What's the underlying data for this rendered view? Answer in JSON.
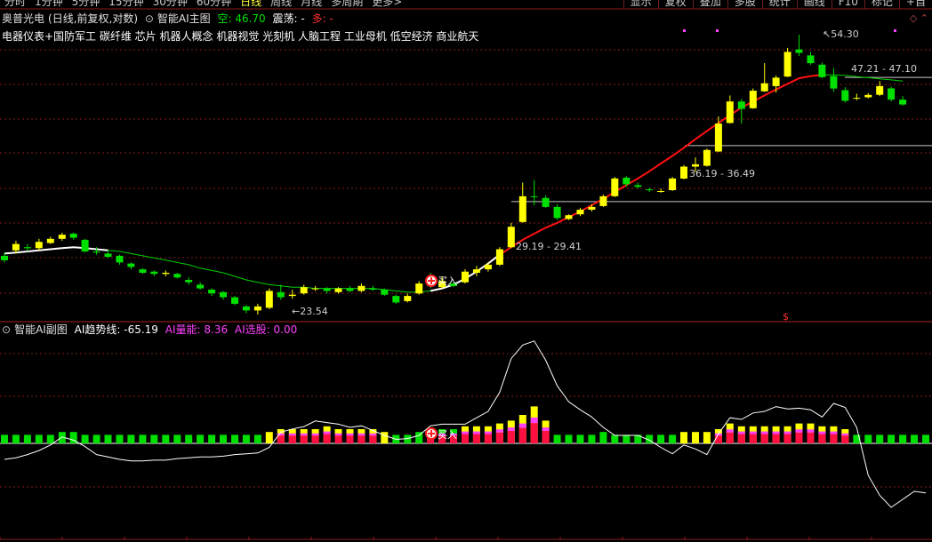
{
  "topbar": {
    "periods": [
      "分时",
      "1分钟",
      "5分钟",
      "15分钟",
      "30分钟",
      "60分钟",
      "日线",
      "周线",
      "月线",
      "多周期",
      "更多>"
    ],
    "active_period": "日线",
    "tools": [
      "显示",
      "复权",
      "叠加",
      "多股",
      "统计",
      "画线",
      "F10",
      "标记",
      "+自"
    ]
  },
  "main_header": {
    "stock": "奥普光电",
    "mode": "(日线,前复权,对数)",
    "indicator": "智能AI主图",
    "empty_label": "空: 46.70",
    "oscillation_label": "震荡: -",
    "long_label": "多: -"
  },
  "concepts": "电器仪表+国防军工 碳纤维 芯片 机器人概念 机器视觉 光刻机 人脑工程 工业母机 低空经济 商业航天",
  "sub_header": {
    "indicator": "智能AI副图",
    "trend_label": "AI趋势线: -65.19",
    "volume_label": "AI量能: 8.36",
    "select_label": "AI选股: 0.00"
  },
  "annotations": {
    "low_price": "23.54",
    "level_a": "29.19 - 29.41",
    "level_b": "36.19 - 36.49",
    "high_price": "54.30",
    "level_c": "47.21 - 47.10",
    "buy_label": "买入",
    "dollar_mark": "$"
  },
  "colors": {
    "background": "#000000",
    "up_yellow": "#ffff00",
    "down_green": "#00e000",
    "flat_white": "#ffffff",
    "red_line": "#ff1010",
    "green_line": "#00d000",
    "magenta": "#ff40ff",
    "grid_red": "#8a1a1a"
  },
  "icons": {
    "header_dot": "circle-chevron-icon",
    "buy_marker": "buy-marker-icon"
  },
  "chart_data": [
    {
      "type": "candlestick",
      "title": "智能AI主图",
      "y_scale": "log",
      "series": [
        {
          "name": "candles",
          "ohlc": [
            [
              23.8,
              24.1,
              23.2,
              23.4
            ],
            [
              24.3,
              25.2,
              24.0,
              24.9
            ],
            [
              24.6,
              24.9,
              24.2,
              24.5
            ],
            [
              24.5,
              25.4,
              24.3,
              25.1
            ],
            [
              25.0,
              25.6,
              24.9,
              25.4
            ],
            [
              25.4,
              26.0,
              25.2,
              25.8
            ],
            [
              25.9,
              26.0,
              25.3,
              25.5
            ],
            [
              25.3,
              25.4,
              24.1,
              24.2
            ],
            [
              24.2,
              24.6,
              23.9,
              24.1
            ],
            [
              24.0,
              24.2,
              23.6,
              23.7
            ],
            [
              23.8,
              23.9,
              23.0,
              23.2
            ],
            [
              23.1,
              23.2,
              22.6,
              22.8
            ],
            [
              22.6,
              22.7,
              22.2,
              22.3
            ],
            [
              22.4,
              22.5,
              22.0,
              22.2
            ],
            [
              22.2,
              22.5,
              22.0,
              22.3
            ],
            [
              22.2,
              22.3,
              21.8,
              21.9
            ],
            [
              21.7,
              21.9,
              21.3,
              21.5
            ],
            [
              21.3,
              21.5,
              20.9,
              21.0
            ],
            [
              20.9,
              21.0,
              20.4,
              20.6
            ],
            [
              20.7,
              20.8,
              20.1,
              20.3
            ],
            [
              20.3,
              20.4,
              19.7,
              19.8
            ],
            [
              19.6,
              19.7,
              19.1,
              19.3
            ],
            [
              19.3,
              19.8,
              19.0,
              19.6
            ],
            [
              19.5,
              21.0,
              19.4,
              20.8
            ],
            [
              20.7,
              21.3,
              20.1,
              20.3
            ],
            [
              20.4,
              20.9,
              20.2,
              20.5
            ],
            [
              20.6,
              21.3,
              20.5,
              21.1
            ],
            [
              21.0,
              21.2,
              20.8,
              21.0
            ],
            [
              21.0,
              21.1,
              20.6,
              20.8
            ],
            [
              20.7,
              21.1,
              20.6,
              21.0
            ],
            [
              21.0,
              21.2,
              20.7,
              20.8
            ],
            [
              20.8,
              21.4,
              20.7,
              21.2
            ],
            [
              21.0,
              21.2,
              20.8,
              20.9
            ],
            [
              20.9,
              21.0,
              20.4,
              20.5
            ],
            [
              20.4,
              20.5,
              19.8,
              19.9
            ],
            [
              20.0,
              20.6,
              19.9,
              20.4
            ],
            [
              20.6,
              21.6,
              20.5,
              21.4
            ],
            [
              21.4,
              22.3,
              21.0,
              21.2
            ],
            [
              21.1,
              22.0,
              21.0,
              21.6
            ],
            [
              21.4,
              21.5,
              21.1,
              21.2
            ],
            [
              21.5,
              22.6,
              21.4,
              22.4
            ],
            [
              22.3,
              22.9,
              22.0,
              22.6
            ],
            [
              22.6,
              23.2,
              22.4,
              23.0
            ],
            [
              23.0,
              24.6,
              22.9,
              24.4
            ],
            [
              24.6,
              27.0,
              24.5,
              26.6
            ],
            [
              27.1,
              31.5,
              27.0,
              29.9
            ],
            [
              29.9,
              31.8,
              28.9,
              29.8
            ],
            [
              29.7,
              30.0,
              28.6,
              28.7
            ],
            [
              28.7,
              29.0,
              27.3,
              27.5
            ],
            [
              27.4,
              27.9,
              27.3,
              27.8
            ],
            [
              27.9,
              28.6,
              27.7,
              28.4
            ],
            [
              28.4,
              29.0,
              28.2,
              28.7
            ],
            [
              28.8,
              30.1,
              28.7,
              29.9
            ],
            [
              29.9,
              32.2,
              29.8,
              32.0
            ],
            [
              32.1,
              32.3,
              31.0,
              31.3
            ],
            [
              31.2,
              31.5,
              30.8,
              31.0
            ],
            [
              30.7,
              30.9,
              30.4,
              30.6
            ],
            [
              30.5,
              30.8,
              30.3,
              30.5
            ],
            [
              30.6,
              32.2,
              30.5,
              32.0
            ],
            [
              32.0,
              33.7,
              31.9,
              33.5
            ],
            [
              33.5,
              34.7,
              32.8,
              33.8
            ],
            [
              33.6,
              35.9,
              33.5,
              35.7
            ],
            [
              35.5,
              40.6,
              35.4,
              39.5
            ],
            [
              39.6,
              44.0,
              39.5,
              43.0
            ],
            [
              43.0,
              43.4,
              39.5,
              41.8
            ],
            [
              41.9,
              45.2,
              41.8,
              44.8
            ],
            [
              44.7,
              49.8,
              44.6,
              46.1
            ],
            [
              45.6,
              47.5,
              44.5,
              47.1
            ],
            [
              47.3,
              52.8,
              47.2,
              52.0
            ],
            [
              52.5,
              55.5,
              51.2,
              51.8
            ],
            [
              51.3,
              52.0,
              49.5,
              49.8
            ],
            [
              49.5,
              49.9,
              47.0,
              47.2
            ],
            [
              47.4,
              48.9,
              44.6,
              45.2
            ],
            [
              44.9,
              45.4,
              42.8,
              43.1
            ],
            [
              43.6,
              44.3,
              43.2,
              43.6
            ],
            [
              43.7,
              44.4,
              43.5,
              44.1
            ],
            [
              44.1,
              46.5,
              43.9,
              45.6
            ],
            [
              45.2,
              45.5,
              43.0,
              43.3
            ],
            [
              43.3,
              43.9,
              42.3,
              42.5
            ]
          ]
        },
        {
          "name": "ma_line",
          "values": [
            24.0,
            24.1,
            24.2,
            24.3,
            24.4,
            24.5,
            24.6,
            24.5,
            24.4,
            24.3,
            24.2,
            24.0,
            23.8,
            23.6,
            23.4,
            23.2,
            23.0,
            22.7,
            22.5,
            22.3,
            22.0,
            21.7,
            21.5,
            21.3,
            21.2,
            21.1,
            21.1,
            21.0,
            21.0,
            21.0,
            21.0,
            21.0,
            21.0,
            20.9,
            20.8,
            20.7,
            20.7,
            20.8,
            21.0,
            21.3,
            21.8,
            22.4,
            23.1,
            23.9,
            24.6,
            25.3,
            25.9,
            26.5,
            27.0,
            27.6,
            28.2,
            28.9,
            29.6,
            30.4,
            31.2,
            32.0,
            32.9,
            33.9,
            34.9,
            36.0,
            37.2,
            38.4,
            39.6,
            40.8,
            42.0,
            43.0,
            44.0,
            45.0,
            46.0,
            47.0,
            47.4,
            47.6,
            47.6,
            47.5,
            47.3,
            47.1,
            46.9,
            46.7,
            46.5
          ]
        }
      ],
      "annotations": [
        "23.54",
        "29.19 - 29.41",
        "36.19 - 36.49",
        "54.30",
        "47.21 - 47.10"
      ]
    },
    {
      "type": "bar",
      "title": "智能AI副图",
      "series": [
        {
          "name": "AI趋势线",
          "values": [
            -20,
            -18,
            -14,
            -9,
            -2,
            8,
            4,
            -4,
            -14,
            -17,
            -20,
            -22,
            -22,
            -21,
            -21,
            -19,
            -18,
            -17,
            -17,
            -16,
            -14,
            -13,
            -12,
            -5,
            14,
            18,
            21,
            28,
            26,
            24,
            20,
            22,
            16,
            10,
            5,
            6,
            10,
            22,
            24,
            24,
            24,
            32,
            40,
            64,
            106,
            123,
            128,
            104,
            72,
            52,
            42,
            33,
            20,
            10,
            10,
            10,
            4,
            -5,
            -13,
            -2,
            -7,
            -14,
            12,
            32,
            30,
            38,
            40,
            46,
            43,
            44,
            42,
            33,
            50,
            45,
            20,
            -40,
            -65,
            -80,
            -70,
            -60,
            -62
          ]
        },
        {
          "name": "AI量能",
          "values": [
            3,
            3,
            3,
            3,
            3,
            4,
            4,
            3,
            3,
            3,
            3,
            3,
            3,
            3,
            3,
            3,
            3,
            3,
            3,
            3,
            3,
            3,
            3,
            4,
            5,
            5,
            5,
            5,
            6,
            5,
            5,
            5,
            5,
            4,
            3,
            3,
            4,
            5,
            5,
            5,
            6,
            6,
            6,
            7,
            8,
            10,
            13,
            8,
            3,
            3,
            3,
            3,
            4,
            3,
            3,
            3,
            3,
            3,
            3,
            4,
            4,
            4,
            5,
            7,
            6,
            6,
            6,
            6,
            6,
            7,
            7,
            6,
            6,
            5,
            3,
            3,
            3,
            3,
            3,
            3,
            3
          ]
        }
      ]
    }
  ]
}
